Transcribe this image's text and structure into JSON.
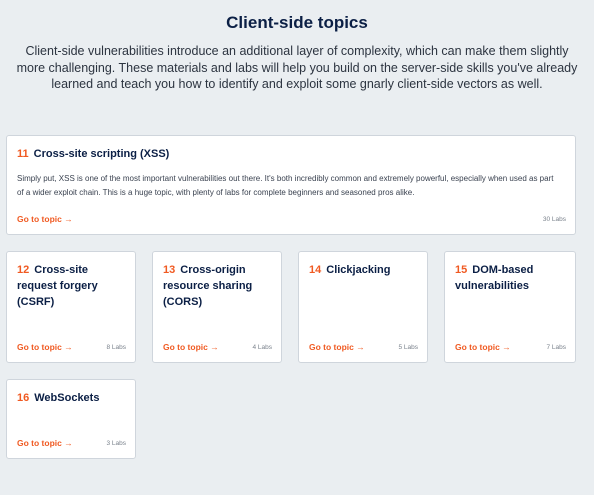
{
  "header": {
    "title": "Client-side topics",
    "intro": "Client-side vulnerabilities introduce an additional layer of complexity, which can make them slightly more challenging. These materials and labs will help you build on the server-side skills you've already learned and teach you how to identify and exploit some gnarly client-side vectors as well."
  },
  "topics": [
    {
      "number": "11",
      "title": "Cross-site scripting (XSS)",
      "description": "Simply put, XSS is one of the most important vulnerabilities out there. It's both incredibly common and extremely powerful, especially when used as part of a wider exploit chain. This is a huge topic, with plenty of labs for complete beginners and seasoned pros alike.",
      "link_label": "Go to topic →",
      "labs": "30 Labs"
    },
    {
      "number": "12",
      "title": "Cross-site request forgery (CSRF)",
      "link_label": "Go to topic →",
      "labs": "8 Labs"
    },
    {
      "number": "13",
      "title": "Cross-origin resource sharing (CORS)",
      "link_label": "Go to topic →",
      "labs": "4 Labs"
    },
    {
      "number": "14",
      "title": "Clickjacking",
      "link_label": "Go to topic →",
      "labs": "5 Labs"
    },
    {
      "number": "15",
      "title": "DOM-based vulnerabilities",
      "link_label": "Go to topic →",
      "labs": "7 Labs"
    },
    {
      "number": "16",
      "title": "WebSockets",
      "link_label": "Go to topic →",
      "labs": "3 Labs"
    }
  ],
  "colors": {
    "accent": "#f05a22",
    "heading": "#0b1f45",
    "background": "#eaeef1"
  }
}
